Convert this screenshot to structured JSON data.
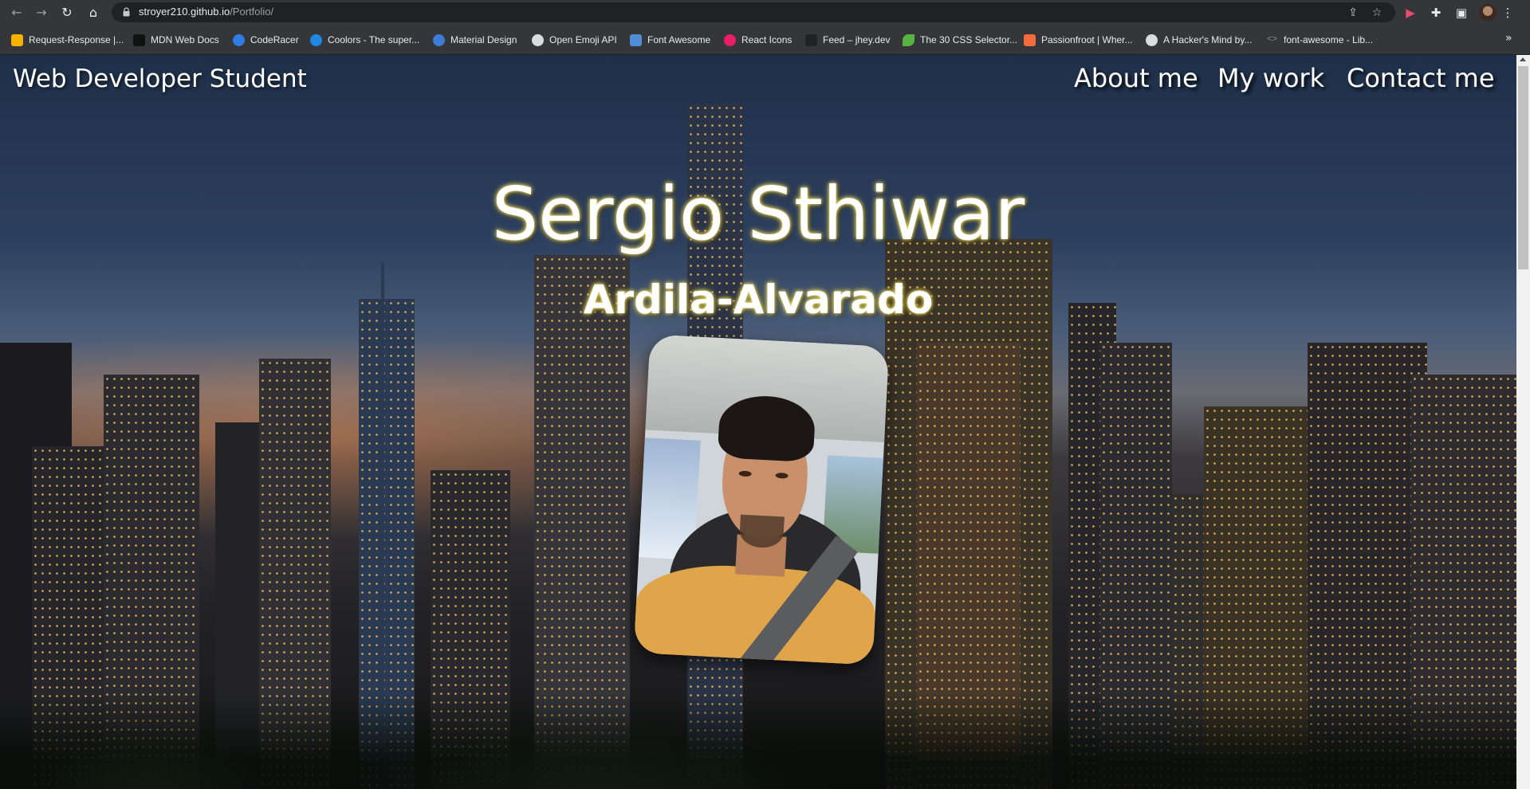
{
  "browser": {
    "url_host": "stroyer210.github.io",
    "url_path": "/Portfolio/",
    "bookmarks": [
      {
        "label": "Request-Response |...",
        "color": "#f5b301"
      },
      {
        "label": "MDN Web Docs",
        "color": "#111111"
      },
      {
        "label": "CodeRacer",
        "color": "#2f7de1"
      },
      {
        "label": "Coolors - The super...",
        "color": "#1e88e5"
      },
      {
        "label": "Material Design",
        "color": "#3f7bd8"
      },
      {
        "label": "Open Emoji API",
        "color": "#dadce0"
      },
      {
        "label": "Font Awesome",
        "color": "#528dd7"
      },
      {
        "label": "React Icons",
        "color": "#e91e63"
      },
      {
        "label": "Feed – jhey.dev",
        "color": "#222222"
      },
      {
        "label": "The 30 CSS Selector...",
        "color": "#59b340"
      },
      {
        "label": "Passionfroot | Wher...",
        "color": "#f26b3a"
      },
      {
        "label": "A Hacker's Mind by...",
        "color": "#dadce0"
      },
      {
        "label": "font-awesome - Lib...",
        "color": "#8e8e8e"
      }
    ],
    "more": "»"
  },
  "site": {
    "title": "Web Developer Student",
    "nav": [
      "About me",
      "My work",
      "Contact me"
    ],
    "hero_name": "Sergio Sthiwar",
    "hero_surname": "Ardila-Alvarado",
    "glow_color": "#e9d54f"
  }
}
